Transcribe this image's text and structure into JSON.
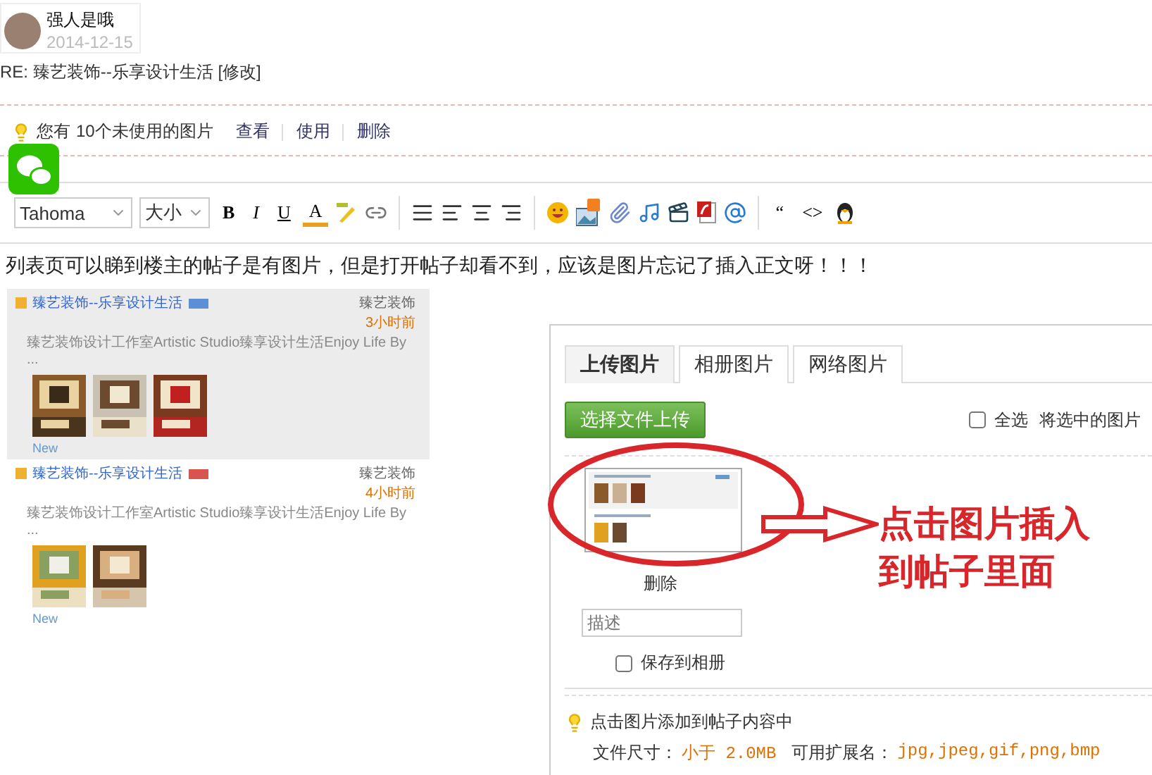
{
  "post": {
    "author": "强人是哦",
    "date": "2014-12-15",
    "title": "RE: 臻艺装饰--乐享设计生活",
    "edit_link": "[修改]"
  },
  "notice": {
    "prefix": "您有",
    "count_text": "10个未使用的图片",
    "actions": [
      "查看",
      "使用",
      "删除"
    ]
  },
  "toolbar": {
    "font": "Tahoma",
    "size": "大小",
    "format_buttons": [
      {
        "kind": "bold",
        "label": "B"
      },
      {
        "kind": "italic",
        "label": "I"
      },
      {
        "kind": "underline",
        "label": "U"
      },
      {
        "kind": "color",
        "label": "A"
      }
    ],
    "code_buttons": [
      "“",
      "<>"
    ]
  },
  "body_text": "列表页可以睇到楼主的帖子是有图片，但是打开帖子却看不到，应该是图片忘记了插入正文呀！！！",
  "embedded_list": {
    "items": [
      {
        "title": "臻艺装饰--乐享设计生活",
        "summary": "臻艺装饰设计工作室Artistic Studio臻享设计生活Enjoy Life By ...",
        "author": "臻艺装饰",
        "time": "3小时前",
        "tag": {
          "color": "#5b8fd6"
        },
        "footer": "New",
        "highlighted": true
      },
      {
        "title": "臻艺装饰--乐享设计生活",
        "summary": "臻艺装饰设计工作室Artistic Studio臻享设计生活Enjoy Life By ...",
        "author": "臻艺装饰",
        "time": "4小时前",
        "tag": {
          "color": "#d9534f"
        },
        "footer": "New",
        "highlighted": false
      }
    ]
  },
  "dialog": {
    "tabs": [
      {
        "label": "上传图片",
        "selected": true
      },
      {
        "label": "相册图片",
        "selected": false
      },
      {
        "label": "网络图片",
        "selected": false
      }
    ],
    "upload_button": "选择文件上传",
    "select_all": {
      "label": "全选",
      "checked": false
    },
    "batch_text": "将选中的图片",
    "delete_link": "删除",
    "description": {
      "placeholder": "描述"
    },
    "save_to_album": {
      "label": "保存到相册",
      "checked": false
    },
    "tip": "点击图片添加到帖子内容中",
    "file_info": {
      "size_label": "文件尺寸：",
      "size_value": "小于 2.0MB",
      "ext_label": "可用扩展名：",
      "ext_value": "jpg,jpeg,gif,png,bmp"
    }
  },
  "annotation": {
    "lines": [
      "点击图片插入",
      "到帖子里面"
    ]
  }
}
